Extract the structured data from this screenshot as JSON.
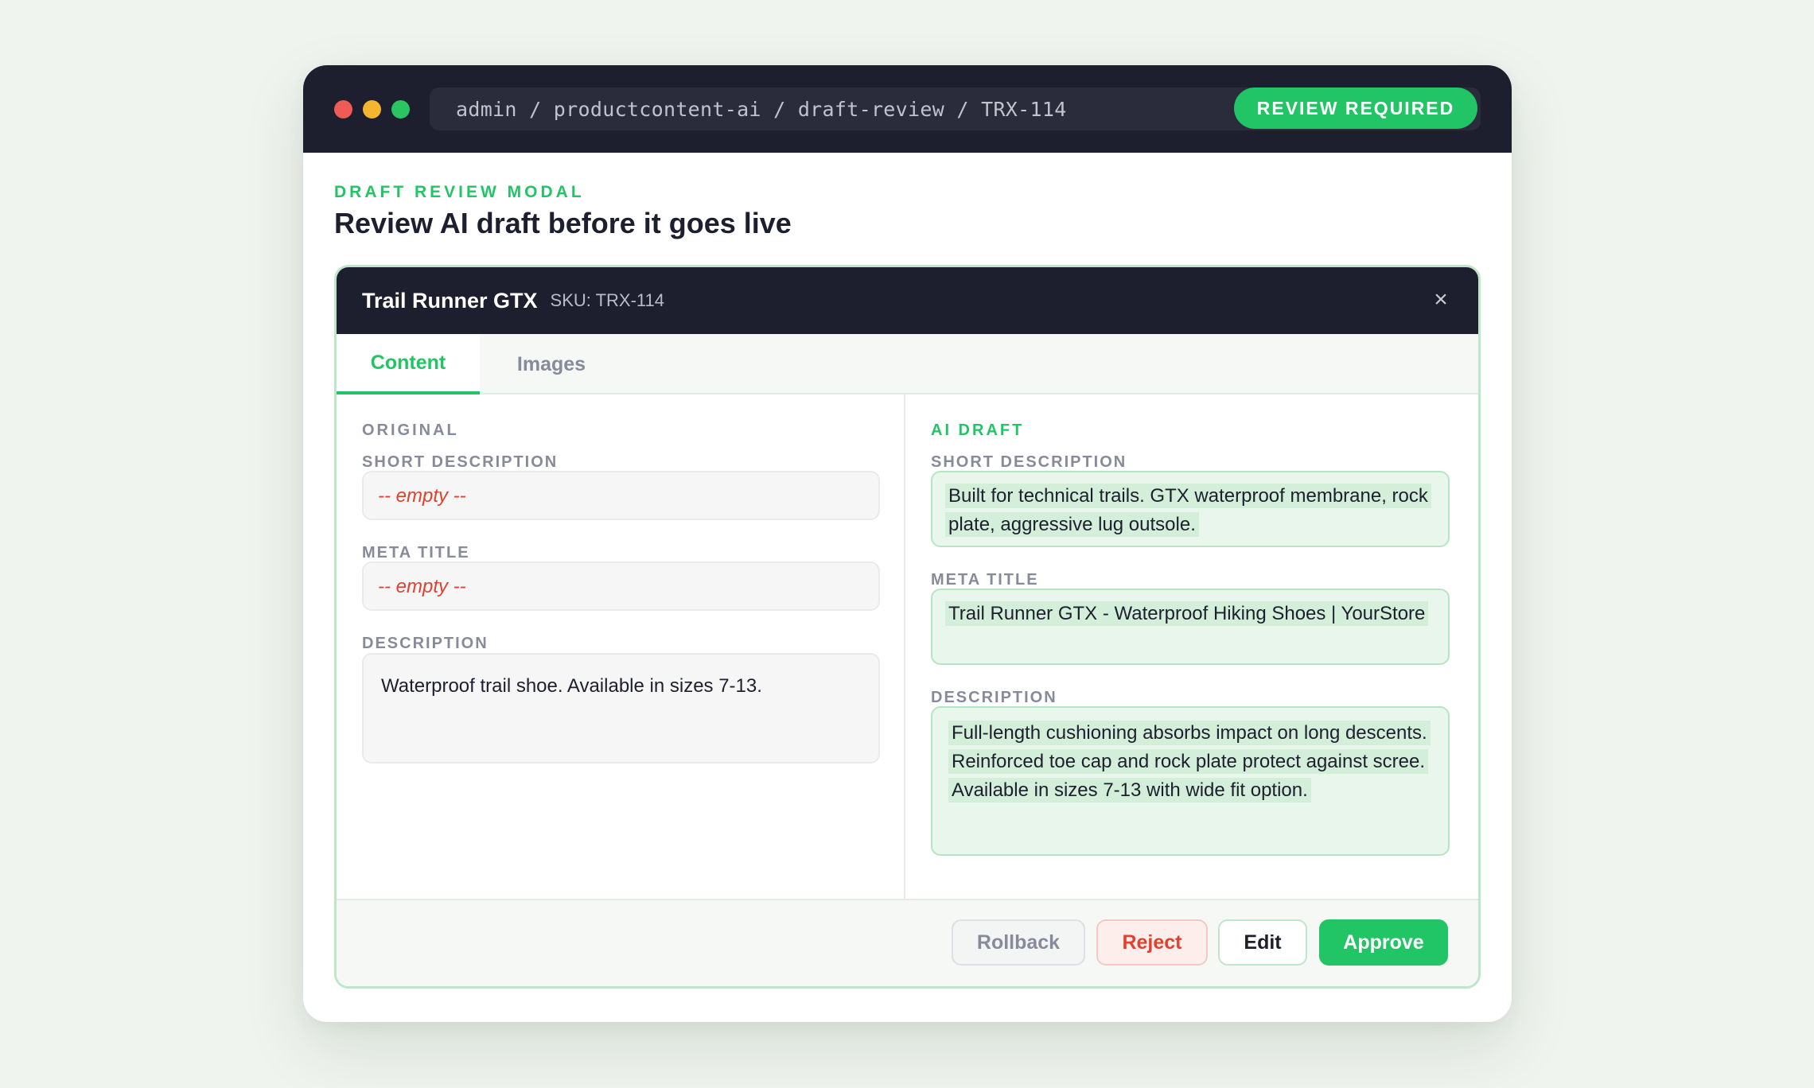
{
  "window": {
    "breadcrumb": "admin / productcontent-ai / draft-review / TRX-114",
    "status_badge": "REVIEW REQUIRED"
  },
  "page": {
    "eyebrow": "DRAFT REVIEW MODAL",
    "heading": "Review AI draft before it goes live"
  },
  "modal": {
    "product_name": "Trail Runner GTX",
    "sku": "SKU: TRX-114",
    "close_icon": "×",
    "tabs": [
      {
        "label": "Content",
        "active": true
      },
      {
        "label": "Images",
        "active": false
      }
    ],
    "original": {
      "title": "ORIGINAL",
      "short_description_label": "SHORT DESCRIPTION",
      "short_description_value": "-- empty --",
      "meta_title_label": "META TITLE",
      "meta_title_value": "-- empty --",
      "description_label": "DESCRIPTION",
      "description_value": "Waterproof trail shoe. Available in sizes 7-13."
    },
    "ai_draft": {
      "title": "AI DRAFT",
      "short_description_label": "SHORT DESCRIPTION",
      "short_description_value": "Built for technical trails. GTX waterproof membrane, rock plate, aggressive lug outsole.",
      "meta_title_label": "META TITLE",
      "meta_title_value": "Trail Runner GTX - Waterproof Hiking Shoes | YourStore",
      "description_label": "DESCRIPTION",
      "description_value": "Full-length cushioning absorbs impact on long descents. Reinforced toe cap and rock plate protect against scree. Available in sizes 7-13 with wide fit option."
    },
    "actions": {
      "rollback": "Rollback",
      "reject": "Reject",
      "edit": "Edit",
      "approve": "Approve"
    }
  },
  "colors": {
    "accent": "#22c565",
    "titlebar": "#1e1f2e",
    "danger": "#e0412f",
    "muted": "#878b99"
  }
}
